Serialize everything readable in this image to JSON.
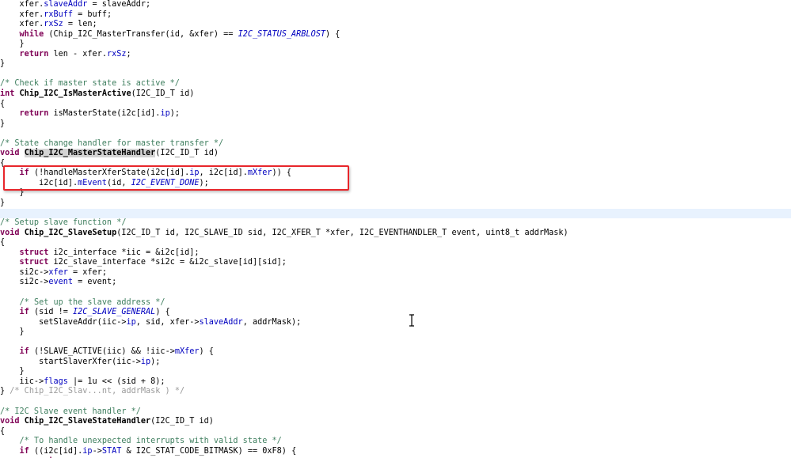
{
  "code": [
    {
      "segs": [
        [
          "",
          "    xfer."
        ],
        [
          "fld",
          "slaveAddr"
        ],
        [
          "",
          " = slaveAddr;"
        ]
      ]
    },
    {
      "segs": [
        [
          "",
          "    xfer."
        ],
        [
          "fld",
          "rxBuff"
        ],
        [
          "",
          " = buff;"
        ]
      ]
    },
    {
      "segs": [
        [
          "",
          "    xfer."
        ],
        [
          "fld",
          "rxSz"
        ],
        [
          "",
          " = len;"
        ]
      ]
    },
    {
      "segs": [
        [
          "",
          "    "
        ],
        [
          "kw",
          "while"
        ],
        [
          "",
          " (Chip_I2C_MasterTransfer(id, &xfer) == "
        ],
        [
          "cst",
          "I2C_STATUS_ARBLOST"
        ],
        [
          "",
          ") {"
        ]
      ]
    },
    {
      "segs": [
        [
          "",
          "    }"
        ]
      ]
    },
    {
      "segs": [
        [
          "",
          "    "
        ],
        [
          "kw",
          "return"
        ],
        [
          "",
          " len - xfer."
        ],
        [
          "fld",
          "rxSz"
        ],
        [
          "",
          ";"
        ]
      ]
    },
    {
      "segs": [
        [
          "",
          "}"
        ]
      ]
    },
    {
      "segs": []
    },
    {
      "segs": [
        [
          "cm",
          "/* Check if master state is active */"
        ]
      ]
    },
    {
      "segs": [
        [
          "kw",
          "int"
        ],
        [
          "",
          " "
        ],
        [
          "fn",
          "Chip_I2C_IsMasterActive"
        ],
        [
          "",
          "(I2C_ID_T id)"
        ]
      ]
    },
    {
      "segs": [
        [
          "",
          "{"
        ]
      ]
    },
    {
      "segs": [
        [
          "",
          "    "
        ],
        [
          "kw",
          "return"
        ],
        [
          "",
          " isMasterState(i2c[id]."
        ],
        [
          "fld",
          "ip"
        ],
        [
          "",
          ");"
        ]
      ]
    },
    {
      "segs": [
        [
          "",
          "}"
        ]
      ]
    },
    {
      "segs": []
    },
    {
      "segs": [
        [
          "cm",
          "/* State change handler for master transfer */"
        ]
      ]
    },
    {
      "segs": [
        [
          "kw",
          "void"
        ],
        [
          "",
          " "
        ],
        [
          "fn occ",
          "Chip_I2C_MasterStateHandler"
        ],
        [
          "",
          "(I2C_ID_T id)"
        ]
      ]
    },
    {
      "segs": [
        [
          "",
          "{"
        ]
      ]
    },
    {
      "segs": [
        [
          "",
          "    "
        ],
        [
          "kw",
          "if"
        ],
        [
          "",
          " (!handleMasterXferState(i2c[id]."
        ],
        [
          "fld",
          "ip"
        ],
        [
          "",
          ", i2c[id]."
        ],
        [
          "fld",
          "mXfer"
        ],
        [
          "",
          ")) {"
        ]
      ]
    },
    {
      "segs": [
        [
          "",
          "        i2c[id]."
        ],
        [
          "fld",
          "mEvent"
        ],
        [
          "",
          "(id, "
        ],
        [
          "cst",
          "I2C_EVENT_DONE"
        ],
        [
          "",
          ");"
        ]
      ]
    },
    {
      "segs": [
        [
          "",
          "    }"
        ]
      ]
    },
    {
      "segs": [
        [
          "",
          "}"
        ]
      ]
    },
    {
      "segs": [],
      "current": true
    },
    {
      "segs": [
        [
          "cm",
          "/* Setup slave function */"
        ]
      ]
    },
    {
      "segs": [
        [
          "kw",
          "void"
        ],
        [
          "",
          " "
        ],
        [
          "fn",
          "Chip_I2C_SlaveSetup"
        ],
        [
          "",
          "(I2C_ID_T id, I2C_SLAVE_ID sid, I2C_XFER_T *xfer, I2C_EVENTHANDLER_T event, uint8_t addrMask)"
        ]
      ]
    },
    {
      "segs": [
        [
          "",
          "{"
        ]
      ]
    },
    {
      "segs": [
        [
          "",
          "    "
        ],
        [
          "kw",
          "struct"
        ],
        [
          "",
          " i2c_interface *iic = &i2c[id];"
        ]
      ]
    },
    {
      "segs": [
        [
          "",
          "    "
        ],
        [
          "kw",
          "struct"
        ],
        [
          "",
          " i2c_slave_interface *si2c = &i2c_slave[id][sid];"
        ]
      ]
    },
    {
      "segs": [
        [
          "",
          "    si2c->"
        ],
        [
          "fld",
          "xfer"
        ],
        [
          "",
          " = xfer;"
        ]
      ]
    },
    {
      "segs": [
        [
          "",
          "    si2c->"
        ],
        [
          "fld",
          "event"
        ],
        [
          "",
          " = event;"
        ]
      ]
    },
    {
      "segs": []
    },
    {
      "segs": [
        [
          "",
          "    "
        ],
        [
          "cm",
          "/* Set up the slave address */"
        ]
      ]
    },
    {
      "segs": [
        [
          "",
          "    "
        ],
        [
          "kw",
          "if"
        ],
        [
          "",
          " (sid != "
        ],
        [
          "cst",
          "I2C_SLAVE_GENERAL"
        ],
        [
          "",
          ") {"
        ]
      ]
    },
    {
      "segs": [
        [
          "",
          "        setSlaveAddr(iic->"
        ],
        [
          "fld",
          "ip"
        ],
        [
          "",
          ", sid, xfer->"
        ],
        [
          "fld",
          "slaveAddr"
        ],
        [
          "",
          ", addrMask);"
        ]
      ]
    },
    {
      "segs": [
        [
          "",
          "    }"
        ]
      ]
    },
    {
      "segs": []
    },
    {
      "segs": [
        [
          "",
          "    "
        ],
        [
          "kw",
          "if"
        ],
        [
          "",
          " (!SLAVE_ACTIVE(iic) && !iic->"
        ],
        [
          "fld",
          "mXfer"
        ],
        [
          "",
          ") {"
        ]
      ]
    },
    {
      "segs": [
        [
          "",
          "        startSlaverXfer(iic->"
        ],
        [
          "fld",
          "ip"
        ],
        [
          "",
          ");"
        ]
      ]
    },
    {
      "segs": [
        [
          "",
          "    }"
        ]
      ]
    },
    {
      "segs": [
        [
          "",
          "    iic->"
        ],
        [
          "fld",
          "flags"
        ],
        [
          "",
          " |= 1u << (sid + 8);"
        ]
      ]
    },
    {
      "segs": [
        [
          "",
          "} "
        ],
        [
          "dim",
          "/* Chip_I2C_Slav...nt, addrMask ) */"
        ]
      ]
    },
    {
      "segs": []
    },
    {
      "segs": [
        [
          "cm",
          "/* I2C Slave event handler */"
        ]
      ]
    },
    {
      "segs": [
        [
          "kw",
          "void"
        ],
        [
          "",
          " "
        ],
        [
          "fn",
          "Chip_I2C_SlaveStateHandler"
        ],
        [
          "",
          "(I2C_ID_T id)"
        ]
      ]
    },
    {
      "segs": [
        [
          "",
          "{"
        ]
      ]
    },
    {
      "segs": [
        [
          "",
          "    "
        ],
        [
          "cm",
          "/* To handle unexpected interrupts with valid state */"
        ]
      ]
    },
    {
      "segs": [
        [
          "",
          "    "
        ],
        [
          "kw",
          "if"
        ],
        [
          "",
          " ((i2c[id]."
        ],
        [
          "fld",
          "ip"
        ],
        [
          "",
          "->"
        ],
        [
          "fld",
          "STAT"
        ],
        [
          "",
          " & I2C_STAT_CODE_BITMASK) == 0xF8) {"
        ]
      ]
    },
    {
      "segs": [
        [
          "",
          "        "
        ],
        [
          "kw",
          "return"
        ],
        [
          "",
          ";"
        ]
      ]
    }
  ],
  "colors": {
    "keyword": "#7f0055",
    "comment": "#3f7f5f",
    "field": "#0000c0",
    "annotation": "#e8262b",
    "current_line": "#e8f2fe"
  },
  "cursor_icon": "text-cursor-icon"
}
